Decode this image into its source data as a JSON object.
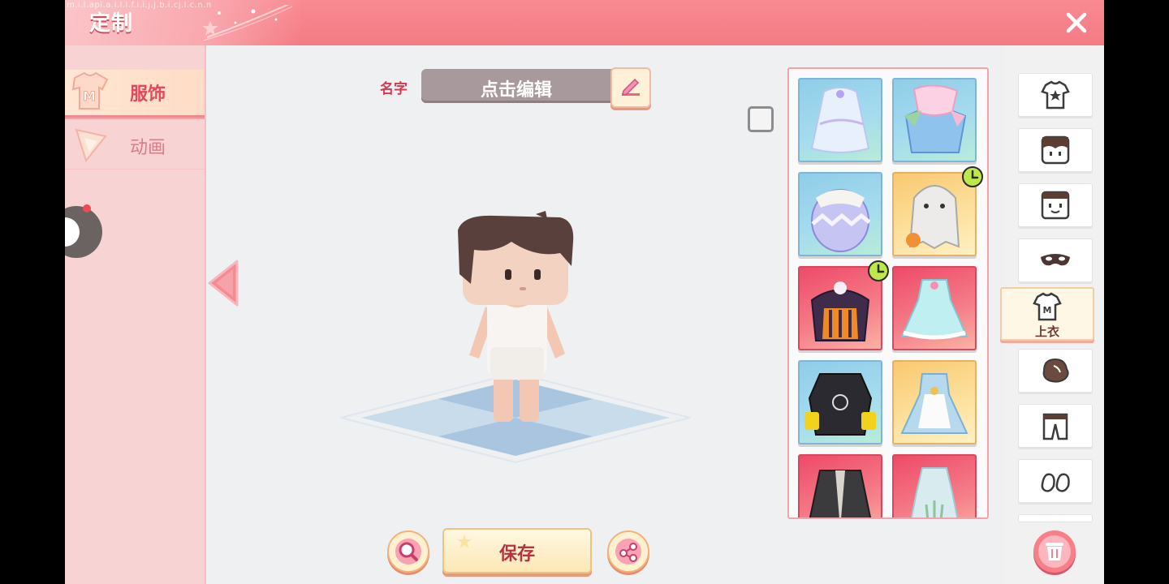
{
  "header": {
    "title": "定制",
    "watermark": "m.i.l.apl.a.i.l.l.f.i.i.j.j.b.i.cj.l.c.n.n"
  },
  "sidebar": {
    "tabs": [
      {
        "label": "服饰",
        "active": true,
        "icon": "shirt-m-icon"
      },
      {
        "label": "动画",
        "active": false,
        "icon": "triangle-icon"
      }
    ]
  },
  "name": {
    "label": "名字",
    "value": "点击编辑",
    "edit_icon": "pencil-icon"
  },
  "outfit_grid": {
    "items": [
      {
        "id": "item-1",
        "bg": "blue",
        "timer": false
      },
      {
        "id": "item-2",
        "bg": "blue",
        "timer": false
      },
      {
        "id": "item-3",
        "bg": "blue",
        "timer": false
      },
      {
        "id": "item-4",
        "bg": "gold",
        "timer": true
      },
      {
        "id": "item-5",
        "bg": "red",
        "timer": true
      },
      {
        "id": "item-6",
        "bg": "red",
        "timer": false
      },
      {
        "id": "item-7",
        "bg": "blue",
        "timer": false
      },
      {
        "id": "item-8",
        "bg": "gold",
        "timer": false
      },
      {
        "id": "item-9",
        "bg": "red",
        "timer": false
      },
      {
        "id": "item-10",
        "bg": "red",
        "timer": false
      }
    ]
  },
  "categories": {
    "items": [
      "outfit-icon",
      "hair-icon",
      "face-icon",
      "mask-icon",
      "top-shirt-icon",
      "glove-icon",
      "pants-icon",
      "shoes-icon"
    ],
    "active_label": "上衣"
  },
  "actions": {
    "save_label": "保存"
  },
  "colors": {
    "accent": "#f47b84",
    "primary_text": "#d5394f",
    "panel": "#f8d3d4"
  }
}
